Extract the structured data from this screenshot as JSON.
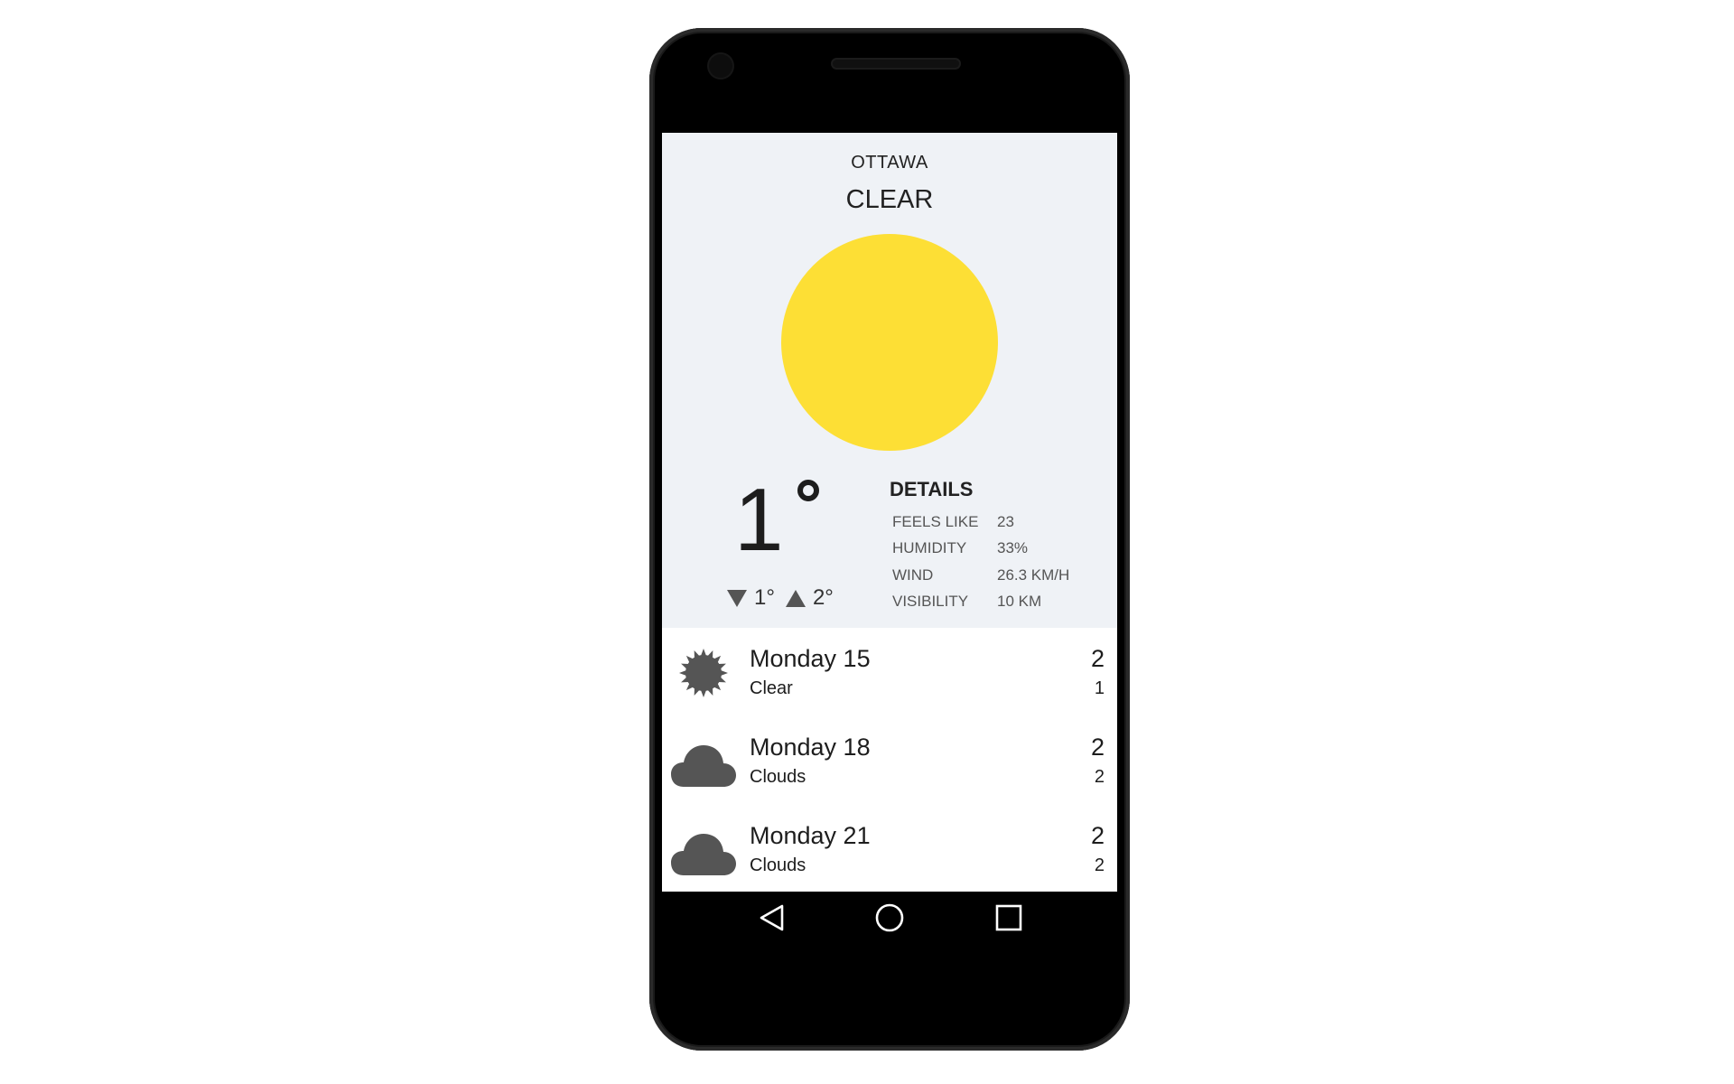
{
  "weather": {
    "city": "OTTAWA",
    "condition": "CLEAR",
    "sun_color": "#fddf35",
    "temperature": "1",
    "min_temp": "1°",
    "max_temp": "2°"
  },
  "details": {
    "title": "DETAILS",
    "rows": [
      {
        "label": "FEELS LIKE",
        "value": "23"
      },
      {
        "label": "HUMIDITY",
        "value": "33%"
      },
      {
        "label": "WIND",
        "value": "26.3 KM/H"
      },
      {
        "label": "VISIBILITY",
        "value": "10 KM"
      }
    ]
  },
  "forecast": [
    {
      "day": "Monday 15",
      "desc": "Clear",
      "hi": "2",
      "lo": "1",
      "icon": "sun-icon"
    },
    {
      "day": "Monday 18",
      "desc": "Clouds",
      "hi": "2",
      "lo": "2",
      "icon": "cloud-icon"
    },
    {
      "day": "Monday 21",
      "desc": "Clouds",
      "hi": "2",
      "lo": "2",
      "icon": "cloud-icon"
    }
  ],
  "navbar": {
    "back": "back-triangle-icon",
    "home": "home-circle-icon",
    "recents": "recents-square-icon"
  }
}
